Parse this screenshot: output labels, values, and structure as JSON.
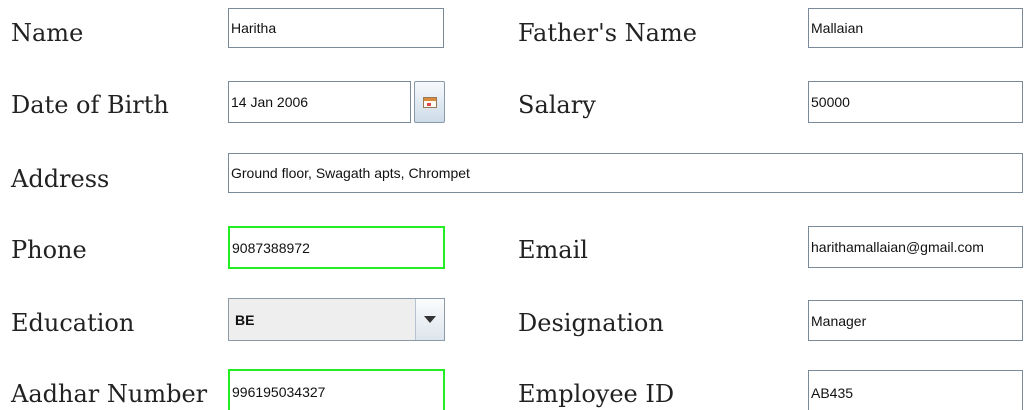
{
  "form": {
    "labels": {
      "name": "Name",
      "fathers_name": "Father's Name",
      "date_of_birth": "Date of Birth",
      "salary": "Salary",
      "address": "Address",
      "phone": "Phone",
      "email": "Email",
      "education": "Education",
      "designation": "Designation",
      "aadhar_number": "Aadhar Number",
      "employee_id": "Employee ID"
    },
    "values": {
      "name": "Haritha",
      "fathers_name": "Mallaian",
      "date_of_birth": "14 Jan 2006",
      "salary": "50000",
      "address": "Ground floor, Swagath apts, Chrompet",
      "phone": "9087388972",
      "email": "harithamallaian@gmail.com",
      "education": "BE",
      "designation": "Manager",
      "aadhar_number": "996195034327",
      "employee_id": "AB435"
    },
    "highlight_color": "#22ee22",
    "icons": {
      "date_picker": "calendar-icon",
      "education_dropdown": "chevron-down-icon"
    }
  }
}
